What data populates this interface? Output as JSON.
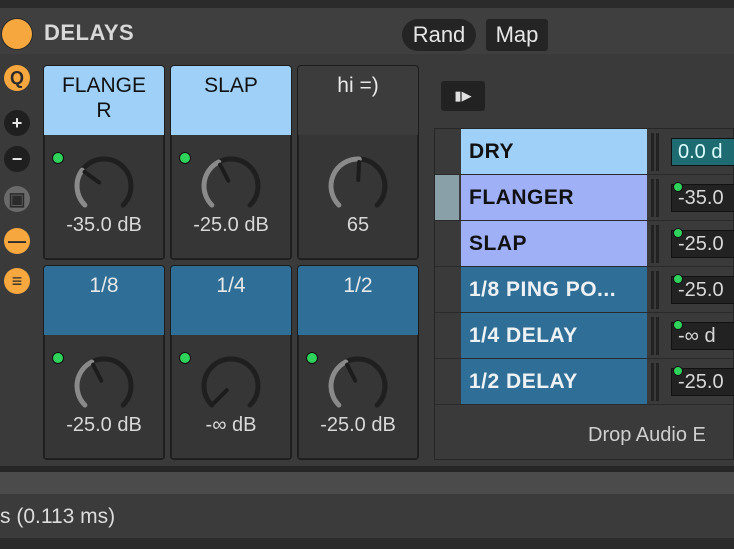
{
  "header": {
    "title": "DELAYS",
    "rand_label": "Rand",
    "map_label": "Map"
  },
  "left_icons": [
    {
      "name": "hot-swap-icon",
      "glyph": "Q"
    },
    {
      "name": "add-icon",
      "glyph": "+"
    },
    {
      "name": "remove-icon",
      "glyph": "−"
    },
    {
      "name": "camera-icon",
      "glyph": "▣"
    },
    {
      "name": "macro-variations-icon",
      "glyph": "—"
    },
    {
      "name": "list-icon",
      "glyph": "≡"
    }
  ],
  "macros": [
    {
      "label": "FLANGE\nR",
      "value": "-35.0 dB",
      "color": "#9fd0f7",
      "led": true,
      "level": 0.3
    },
    {
      "label": "SLAP",
      "value": "-25.0 dB",
      "color": "#9fd0f7",
      "led": true,
      "level": 0.4
    },
    {
      "label": "hi =)",
      "value": "65",
      "color": "#3c3c3c",
      "led": false,
      "level": 0.51
    },
    {
      "label": "1/8",
      "value": "-25.0 dB",
      "color": "#2f6f97",
      "led": true,
      "level": 0.4
    },
    {
      "label": "1/4",
      "value": "-∞ dB",
      "color": "#2f6f97",
      "led": true,
      "level": 0.0
    },
    {
      "label": "1/2",
      "value": "-25.0 dB",
      "color": "#2f6f97",
      "led": true,
      "level": 0.4
    }
  ],
  "chain": {
    "rows": [
      {
        "name": "DRY",
        "volume": "0.0 d",
        "color": "#9fd0f7",
        "selected": false,
        "vol_accent": true,
        "led": false
      },
      {
        "name": "FLANGER",
        "volume": "-35.0",
        "color": "#9fb0f7",
        "selected": true,
        "vol_accent": false,
        "led": true
      },
      {
        "name": "SLAP",
        "volume": "-25.0",
        "color": "#9fb0f7",
        "selected": false,
        "vol_accent": false,
        "led": true
      },
      {
        "name": "1/8 PING PO...",
        "volume": "-25.0",
        "color": "#2f6f97",
        "selected": false,
        "vol_accent": false,
        "led": true
      },
      {
        "name": "1/4 DELAY",
        "volume": "-∞ d",
        "color": "#2f6f97",
        "selected": false,
        "vol_accent": false,
        "led": true
      },
      {
        "name": "1/2 DELAY",
        "volume": "-25.0",
        "color": "#2f6f97",
        "selected": false,
        "vol_accent": false,
        "led": true
      }
    ],
    "drop_text": "Drop Audio E"
  },
  "status": {
    "text": "s (0.113 ms)"
  },
  "colors": {
    "accent_orange": "#f6a83f",
    "led_green": "#2fd25a",
    "light_blue": "#9fd0f7",
    "dark_blue": "#2f6f97"
  }
}
